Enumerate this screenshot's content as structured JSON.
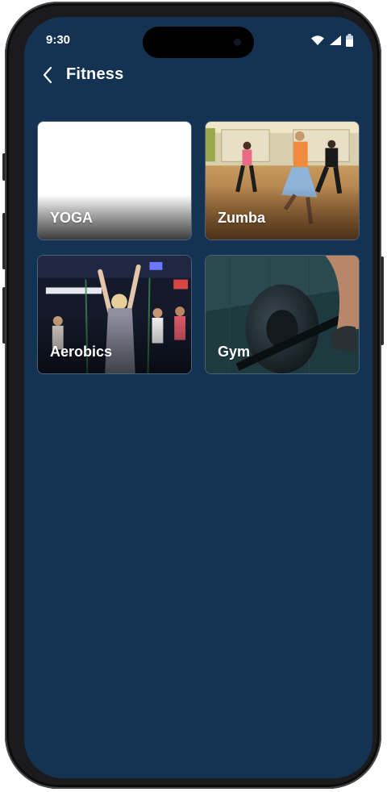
{
  "status_bar": {
    "time": "9:30"
  },
  "header": {
    "title": "Fitness",
    "back_icon": "chevron-left-icon"
  },
  "categories": [
    {
      "label": "YOGA"
    },
    {
      "label": "Zumba"
    },
    {
      "label": "Aerobics"
    },
    {
      "label": "Gym"
    }
  ],
  "colors": {
    "background": "#143251",
    "card_border": "#4c627b",
    "text": "#ffffff"
  }
}
